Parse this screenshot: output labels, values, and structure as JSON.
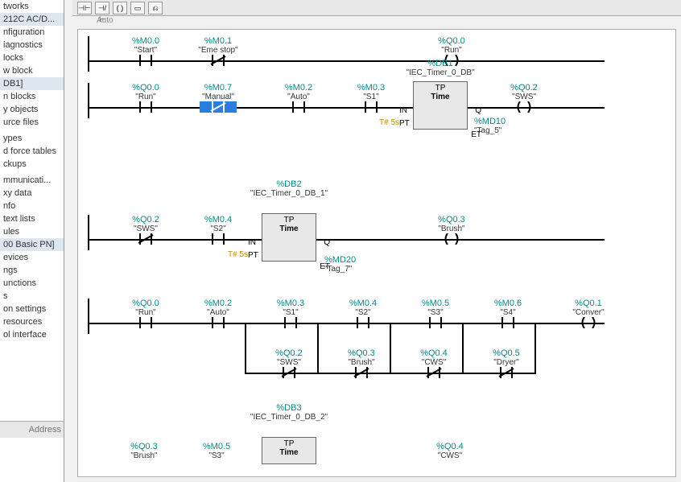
{
  "sidebar": {
    "items": [
      "tworks",
      "212C AC/D...",
      "nfiguration",
      "iagnostics",
      "locks",
      "w block",
      "DB1]",
      "n blocks",
      "y objects",
      "urce files",
      "",
      "ypes",
      "d force tables",
      "ckups",
      "",
      "mmunicati...",
      "xy data",
      "nfo",
      "text lists",
      "ules",
      "00 Basic PN]",
      "evices",
      "ngs",
      "unctions",
      "s",
      "on settings",
      "resources",
      "ol interface"
    ],
    "address_label": "Address"
  },
  "toolbar": {
    "auto": "Auto"
  },
  "rung1": {
    "e1": {
      "addr": "%M0.0",
      "label": "\"Start\""
    },
    "e2": {
      "addr": "%M0.1",
      "label": "\"Eme stop\""
    },
    "coil": {
      "addr": "%Q0.0",
      "label": "\"Run\""
    }
  },
  "rung2": {
    "e1": {
      "addr": "%Q0.0",
      "label": "\"Run\""
    },
    "e2": {
      "addr": "%M0.7",
      "label": "\"Manual\""
    },
    "e3": {
      "addr": "%M0.2",
      "label": "\"Auto\""
    },
    "e4": {
      "addr": "%M0.3",
      "label": "\"S1\""
    },
    "timer": {
      "inst": "%DB1",
      "name": "\"IEC_Timer_0_DB\"",
      "type": "TP",
      "body": "Time",
      "pt": "T# 5s",
      "et_addr": "%MD10",
      "et_name": "\"Tag_5\""
    },
    "coil": {
      "addr": "%Q0.2",
      "label": "\"SWS\""
    }
  },
  "rung3": {
    "e1": {
      "addr": "%Q0.2",
      "label": "\"SWS\""
    },
    "e2": {
      "addr": "%M0.4",
      "label": "\"S2\""
    },
    "timer": {
      "inst": "%DB2",
      "name": "\"IEC_Timer_0_DB_1\"",
      "type": "TP",
      "body": "Time",
      "pt": "T# 5s",
      "et_addr": "%MD20",
      "et_name": "\"Tag_7\""
    },
    "coil": {
      "addr": "%Q0.3",
      "label": "\"Brush\""
    }
  },
  "rung4": {
    "top": {
      "e1": {
        "addr": "%Q0.0",
        "label": "\"Run\""
      },
      "e2": {
        "addr": "%M0.2",
        "label": "\"Auto\""
      },
      "e3": {
        "addr": "%M0.3",
        "label": "\"S1\""
      },
      "e4": {
        "addr": "%M0.4",
        "label": "\"S2\""
      },
      "e5": {
        "addr": "%M0.5",
        "label": "\"S3\""
      },
      "e6": {
        "addr": "%M0.6",
        "label": "\"S4\""
      },
      "coil": {
        "addr": "%Q0.1",
        "label": "\"Conver\""
      }
    },
    "bottom": {
      "b1": {
        "addr": "%Q0.2",
        "label": "\"SWS\""
      },
      "b2": {
        "addr": "%Q0.3",
        "label": "\"Brush\""
      },
      "b3": {
        "addr": "%Q0.4",
        "label": "\"CWS\""
      },
      "b4": {
        "addr": "%Q0.5",
        "label": "\"Dryer\""
      }
    }
  },
  "rung5": {
    "e1": {
      "addr": "%Q0.3",
      "label": "\"Brush\""
    },
    "e2": {
      "addr": "%M0.5",
      "label": "\"S3\""
    },
    "timer": {
      "inst": "%DB3",
      "name": "\"IEC_Timer_0_DB_2\"",
      "type": "TP",
      "body": "Time"
    },
    "coil": {
      "addr": "%Q0.4",
      "label": "\"CWS\""
    }
  },
  "labels": {
    "IN": "IN",
    "Q": "Q",
    "PT": "PT",
    "ET": "ET"
  }
}
